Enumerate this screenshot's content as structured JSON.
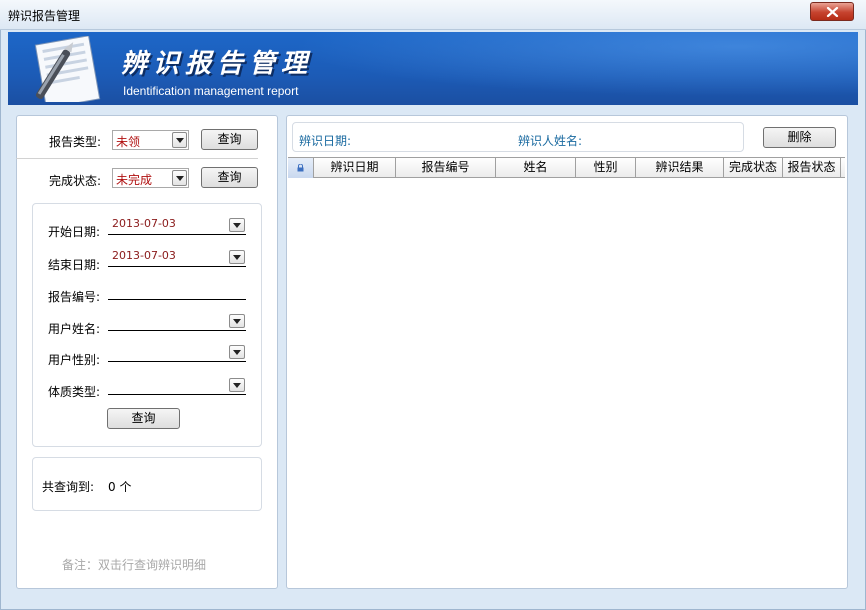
{
  "window": {
    "title": "辨识报告管理",
    "close_icon": "close-icon"
  },
  "banner": {
    "title": "辨识报告管理",
    "subtitle": "Identification management report",
    "icon": "document-pen-icon"
  },
  "left": {
    "report_type": {
      "label": "报告类型:",
      "value": "未领",
      "button": "查询"
    },
    "complete_status": {
      "label": "完成状态:",
      "value": "未完成",
      "button": "查询"
    },
    "search": {
      "start_date": {
        "label": "开始日期:",
        "value": "2013-07-03"
      },
      "end_date": {
        "label": "结束日期:",
        "value": "2013-07-03"
      },
      "report_no": {
        "label": "报告编号:",
        "value": ""
      },
      "user_name": {
        "label": "用户姓名:",
        "value": ""
      },
      "user_gender": {
        "label": "用户性别:",
        "value": ""
      },
      "constitution": {
        "label": "体质类型:",
        "value": ""
      },
      "button": "查询"
    },
    "total": {
      "label": "共查询到:",
      "value": "0 个"
    },
    "note": "备注：双击行查询辨识明细"
  },
  "right": {
    "filter": {
      "date_label": "辨识日期:",
      "person_label": "辨识人姓名:"
    },
    "delete_button": "删除",
    "grid": {
      "columns": [
        "辨识日期",
        "报告编号",
        "姓名",
        "性别",
        "辨识结果",
        "完成状态",
        "报告状态"
      ],
      "rows": []
    }
  },
  "colors": {
    "banner_blue": "#1c5bb6",
    "value_red": "#b01010",
    "label_teal": "#1a6aa0",
    "note_gray": "#a8a8a8"
  }
}
